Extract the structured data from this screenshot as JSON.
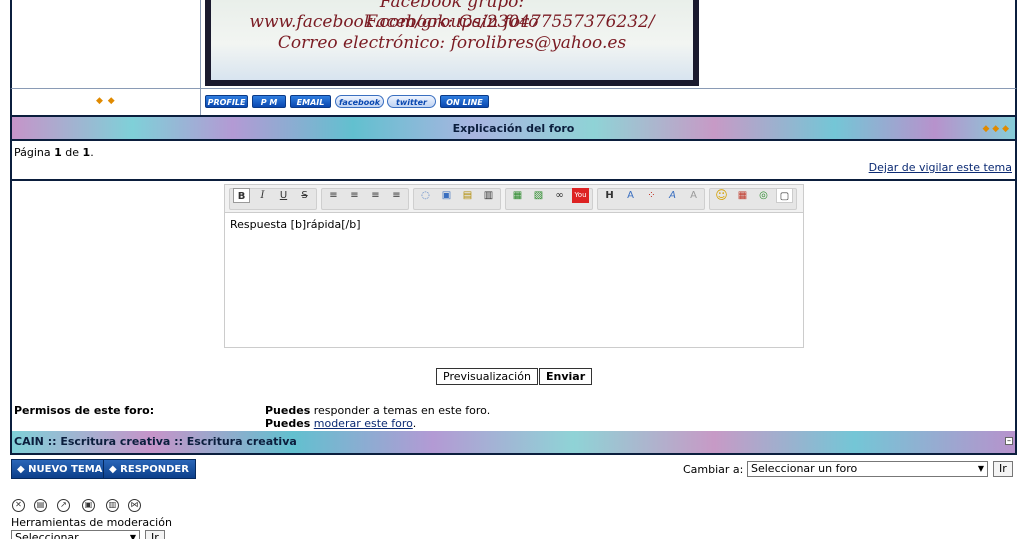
{
  "signature": {
    "line1": "Facebook grupo:  www.facebook.com/groups/230477557376232/",
    "line2": "Facebook: Cain foro",
    "line3": "Correo electrónico: forolibres@yahoo.es"
  },
  "profile_buttons": [
    "PROFILE",
    "P M",
    "EMAIL",
    "facebook",
    "twitter",
    "ON LINE"
  ],
  "topic_bar": {
    "title": "Explicación del foro"
  },
  "pagination": {
    "prefix": "Página ",
    "current": "1",
    "middle": " de ",
    "total": "1",
    "suffix": ".",
    "watch_link": "Dejar de vigilar este tema"
  },
  "editor": {
    "content": "Respuesta [b]rápida[/b]",
    "toolbar": {
      "group1": [
        "B",
        "I",
        "U",
        "S"
      ],
      "group2": [
        "≡",
        "≡",
        "≡",
        "≡"
      ],
      "group3": [
        "◌",
        "▣",
        "▤",
        "▥"
      ],
      "group4": [
        "▦",
        "▧",
        "∞",
        "You"
      ],
      "group5": [
        "H",
        "A",
        "⁘",
        "A",
        "A"
      ],
      "group6": [
        "☺",
        "▦",
        "◎",
        "▢"
      ]
    }
  },
  "actions": {
    "preview": "Previsualización",
    "send": "Enviar"
  },
  "permissions": {
    "label": "Permisos de este foro:",
    "line1_bold": "Puedes",
    "line1_rest": " responder a temas en este foro.",
    "line2_bold": "Puedes",
    "line2_link": "moderar este foro",
    "line2_end": "."
  },
  "breadcrumb": "CAIN :: Escritura creativa :: Escritura creativa",
  "bottom": {
    "new_topic": "◆ NUEVO TEMA",
    "reply": "◆ RESPONDER",
    "change_label": "Cambiar a:",
    "forum_select": "Seleccionar un foro",
    "go": "Ir"
  },
  "moderation": {
    "icons": [
      "✕",
      "▤",
      "↗",
      "▣",
      "▥",
      "⋈"
    ],
    "label": "Herramientas de moderación",
    "select": "Seleccionar",
    "go": "Ir"
  },
  "colors": {
    "frame": "#0b1e3d",
    "link": "#0b2a73",
    "button": "#0c3f8a"
  }
}
